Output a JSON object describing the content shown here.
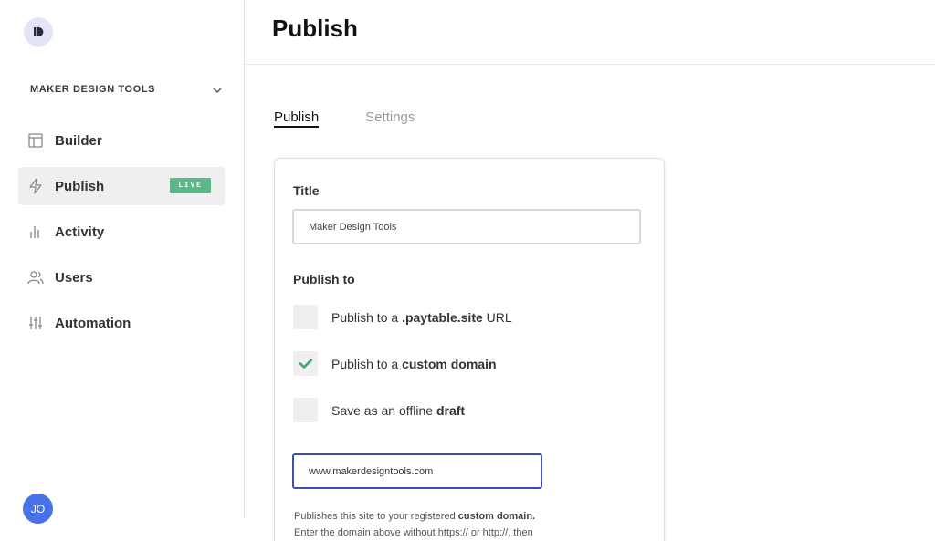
{
  "brand": {
    "logo_icon": "paytable-logo-icon"
  },
  "sidebar": {
    "workspace": "MAKER DESIGN TOOLS",
    "items": [
      {
        "label": "Builder",
        "icon": "layout-icon"
      },
      {
        "label": "Publish",
        "icon": "lightning-icon",
        "badge": "LIVE"
      },
      {
        "label": "Activity",
        "icon": "bar-chart-icon"
      },
      {
        "label": "Users",
        "icon": "users-icon"
      },
      {
        "label": "Automation",
        "icon": "sliders-icon"
      }
    ],
    "user_initials": "JO"
  },
  "header": {
    "title": "Publish"
  },
  "tabs": [
    {
      "label": "Publish",
      "active": true
    },
    {
      "label": "Settings",
      "active": false
    }
  ],
  "form": {
    "title_label": "Title",
    "title_value": "Maker Design Tools",
    "publish_to_label": "Publish to",
    "options": [
      {
        "prefix": "Publish to a ",
        "bold": ".paytable.site",
        "suffix": " URL",
        "checked": false
      },
      {
        "prefix": "Publish to a ",
        "bold": "custom domain",
        "suffix": "",
        "checked": true
      },
      {
        "prefix": "Save as an offline ",
        "bold": "draft",
        "suffix": "",
        "checked": false
      }
    ],
    "domain_value": "www.makerdesigntools.com",
    "help_prefix": "Publishes this site to your registered ",
    "help_bold": "custom domain.",
    "help_line2": "Enter the domain above without https:// or http://, then"
  },
  "colors": {
    "live_badge": "#5cb888",
    "avatar": "#4a72e8",
    "check": "#3fa66a",
    "focus_border": "#3d4faa"
  }
}
